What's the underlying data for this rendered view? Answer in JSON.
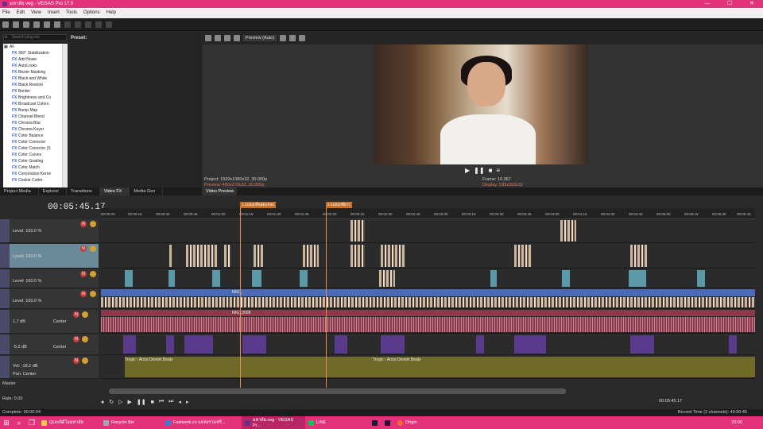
{
  "window": {
    "title": "มหาลัย.veg - VEGAS Pro 17.0",
    "buttons": [
      "—",
      "☐",
      "✕"
    ]
  },
  "menu": [
    "File",
    "Edit",
    "View",
    "Insert",
    "Tools",
    "Options",
    "Help"
  ],
  "fx": {
    "search_placeholder": "Search plug-ins",
    "preset_label": "Preset:",
    "root": "All",
    "items": [
      "360° Stabilization",
      "Add Noise",
      "AutoLooks",
      "Bézier Masking",
      "Black and White",
      "Black Restore",
      "Border",
      "Brightness and Co",
      "Broadcast Colors",
      "Bump Map",
      "Channel Blend",
      "Chroma Blur",
      "Chroma Keyer",
      "Color Balance",
      "Color Corrector",
      "Color Corrector (S",
      "Color Curves",
      "Color Grading",
      "Color Match",
      "Convolution Kerne",
      "Cookie Cutter"
    ]
  },
  "left_tabs": [
    "Project Media",
    "Explorer",
    "Transitions",
    "Video FX",
    "Media Gen"
  ],
  "preview": {
    "mode": "Preview (Auto)",
    "project": "Project:  1920x1080x32, 30.000p",
    "preview": "Preview: 480x270x32, 30.000p",
    "frame": "Frame:  10,367",
    "display": "Display:  539x303x32",
    "tab": "Video Preview"
  },
  "timeline": {
    "timecode": "00:05:45.17",
    "ticks": [
      "00:00:00",
      "00:00:15",
      "00:00:30",
      "00:00:45",
      "00:01:00",
      "00:01:15",
      "00:01:30",
      "00:01:45",
      "00:02:00",
      "00:02:15",
      "00:02:30",
      "00:02:45",
      "00:03:00",
      "00:03:15",
      "00:03:30",
      "00:03:45",
      "00:04:00",
      "00:04:15",
      "00:04:30",
      "00:04:45",
      "00:05:00",
      "00:05:15",
      "00:05:30",
      "00:05:45"
    ],
    "markers": [
      "1 แปลมุกอื่นสุดแหลม",
      "2 แปลมุกที่ยาว"
    ]
  },
  "tracks": [
    {
      "num": "1",
      "level": "Level: 100.0 %"
    },
    {
      "num": "2",
      "level": "Level: 100.0 %"
    },
    {
      "num": "3",
      "level": "Level: 100.0 %"
    },
    {
      "num": "4",
      "level": "Level: 100.0 %"
    },
    {
      "num": "5",
      "level": "1.7 dB",
      "pan": "Center"
    },
    {
      "num": "6",
      "level": "-5.2 dB",
      "pan": "Center"
    },
    {
      "num": "7",
      "level": "Vol:    -18.2 dB",
      "pan": "Pan:     Center"
    }
  ],
  "clips": {
    "video4": "IMG_",
    "audio5": "IMG_0008",
    "music_a": "Tropic - Anno Domini Beats",
    "music_b": "Tropic - Anno Domini Beats"
  },
  "master": "Master",
  "rate": "Rate: 0.00",
  "transport_time": "00:05:45.17",
  "status": {
    "left": "Complete: 00:00:04",
    "right": "Record Time (2 channels): 40:50:45"
  },
  "taskbar": {
    "items": [
      "QUicคิดีโอมหาลัย",
      "Recycle Bin",
      "Fastwork.co แหล่งรวมฟรี...",
      "มหาลัย.veg - VEGAS Pr...",
      "LINE",
      "Origin"
    ],
    "clock": "23:00"
  },
  "colors": {
    "titlebar": "#e2337a",
    "accent": "#e88a4a"
  }
}
